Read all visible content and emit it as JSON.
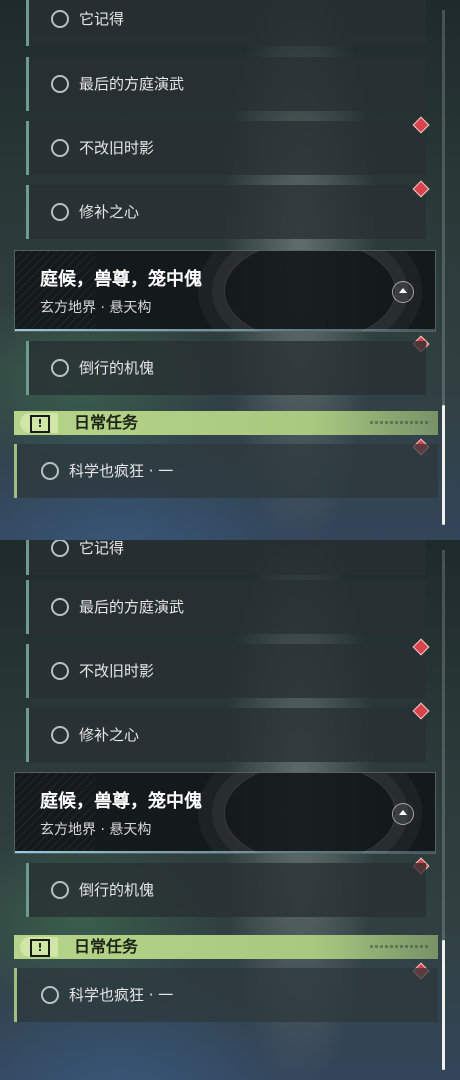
{
  "views": [
    {
      "quests": [
        {
          "label": "它记得"
        },
        {
          "label": "最后的方庭演武"
        },
        {
          "label": "不改旧时影"
        },
        {
          "label": "修补之心"
        }
      ],
      "chapter": {
        "title": "庭候，兽尊，笼中傀",
        "subtitle": "玄方地界 · 悬天构"
      },
      "chapter_quests": [
        {
          "label": "倒行的机傀"
        }
      ],
      "daily": {
        "title": "日常任务",
        "badge_icon": "!",
        "items": [
          {
            "label": "科学也疯狂 · 一"
          }
        ]
      }
    },
    {
      "quests": [
        {
          "label": "它记得"
        },
        {
          "label": "最后的方庭演武"
        },
        {
          "label": "不改旧时影"
        },
        {
          "label": "修补之心"
        }
      ],
      "chapter": {
        "title": "庭候，兽尊，笼中傀",
        "subtitle": "玄方地界 · 悬天构"
      },
      "chapter_quests": [
        {
          "label": "倒行的机傀"
        }
      ],
      "daily": {
        "title": "日常任务",
        "badge_icon": "!",
        "items": [
          {
            "label": "科学也疯狂 · 一"
          }
        ]
      }
    }
  ],
  "colors": {
    "marker": "#d9434b",
    "daily_accent": "#b6d48a",
    "quest_border": "#6f9a8e"
  },
  "icons": {
    "quest_status": "circle-icon",
    "tracked_marker": "diamond-marker-icon",
    "collapse": "chevron-up-icon",
    "daily_badge": "exclamation-box-icon"
  }
}
